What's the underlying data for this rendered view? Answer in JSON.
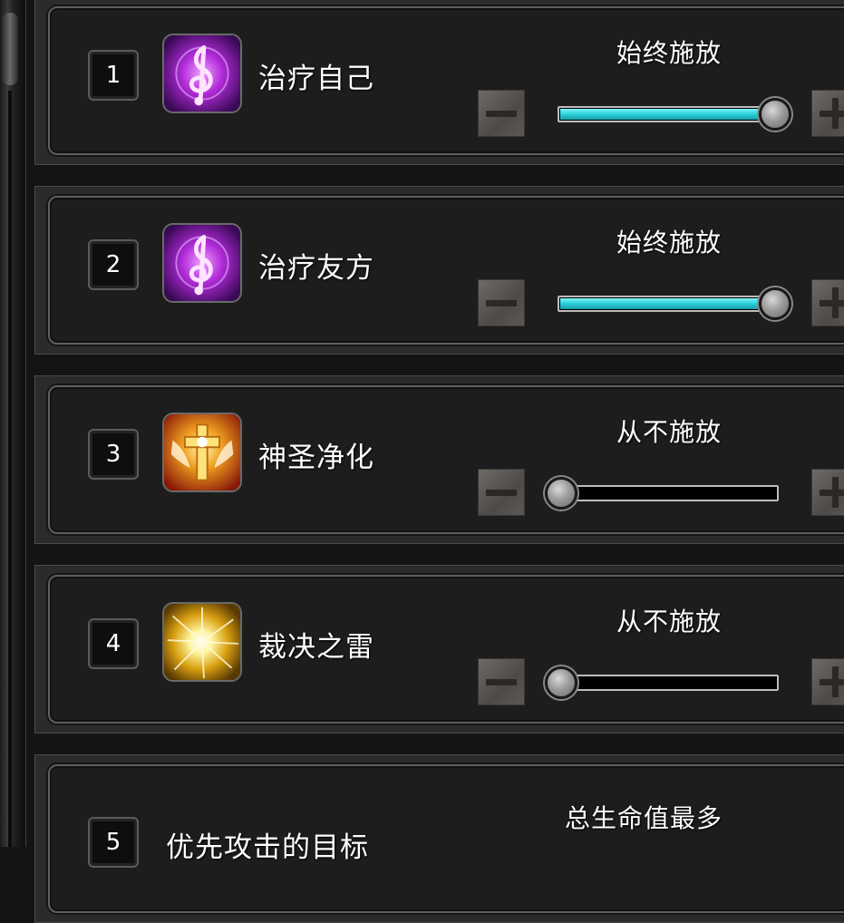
{
  "rows": [
    {
      "number": "1",
      "name": "治疗自己",
      "mode": "始终施放",
      "level": 1.0,
      "icon": "treble-clef-purple-icon"
    },
    {
      "number": "2",
      "name": "治疗友方",
      "mode": "始终施放",
      "level": 1.0,
      "icon": "treble-clef-purple-icon"
    },
    {
      "number": "3",
      "name": "神圣净化",
      "mode": "从不施放",
      "level": 0.0,
      "icon": "holy-cross-wings-icon"
    },
    {
      "number": "4",
      "name": "裁决之雷",
      "mode": "从不施放",
      "level": 0.0,
      "icon": "golden-burst-icon"
    },
    {
      "number": "5",
      "name": "优先攻击的目标",
      "mode": "总生命值最多"
    }
  ],
  "colors": {
    "slider_fill": "#2fd5df",
    "panel_bg": "#1d1d1d",
    "text": "#ffffff"
  }
}
